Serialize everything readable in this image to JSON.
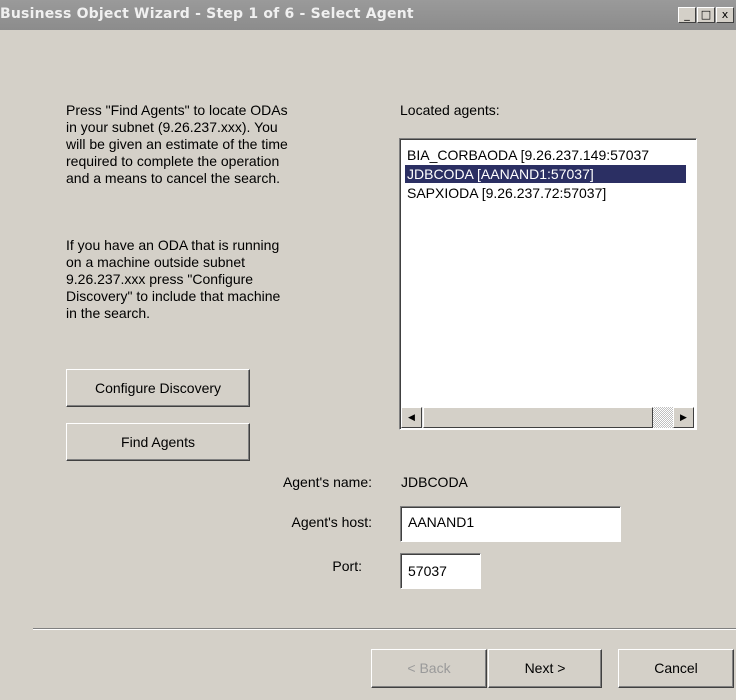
{
  "window": {
    "title": "Business Object Wizard - Step 1 of 6 - Select Agent",
    "controls": {
      "minimize": "_",
      "maximize": "□",
      "close": "x"
    }
  },
  "instructions": {
    "find_text": "Press \"Find Agents\" to locate ODAs\nin your subnet (9.26.237.xxx). You\nwill be given an estimate of the time\nrequired to complete the operation\nand a means to cancel the search.",
    "configure_text": "If you have an ODA that is running\non a machine outside subnet\n9.26.237.xxx press \"Configure\nDiscovery\" to include that machine\nin the search."
  },
  "buttons": {
    "configure_discovery": "Configure Discovery",
    "find_agents": "Find Agents",
    "back": "< Back",
    "next": "Next >",
    "cancel": "Cancel"
  },
  "agents": {
    "label": "Located agents:",
    "items": [
      "BIA_CORBAODA [9.26.237.149:57037",
      "JDBCODA [AANAND1:57037]",
      "SAPXIODA [9.26.237.72:57037]"
    ],
    "selected_index": 1
  },
  "form": {
    "name_label": "Agent's name:",
    "name_value": "JDBCODA",
    "host_label": "Agent's host:",
    "host_value": "AANAND1",
    "port_label": "Port:",
    "port_value": "57037"
  },
  "icons": {
    "scroll_left": "◀",
    "scroll_right": "▶"
  }
}
